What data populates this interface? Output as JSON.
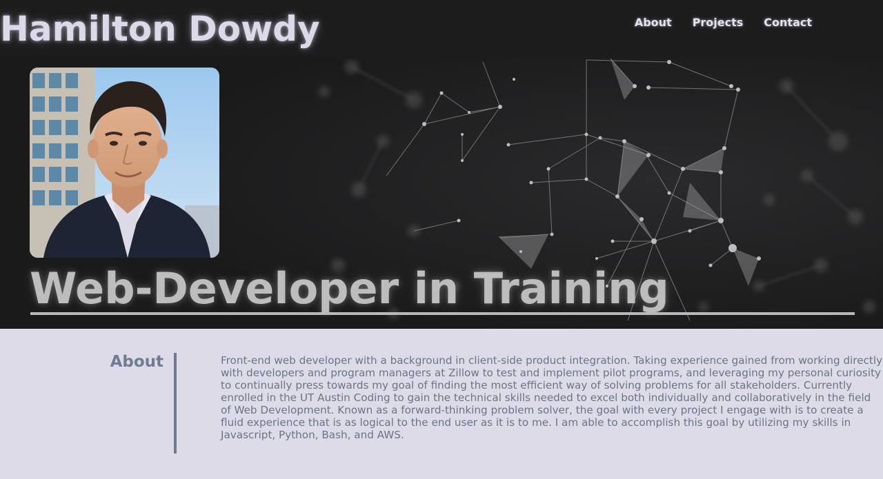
{
  "header": {
    "site_title": "Hamilton Dowdy",
    "nav": [
      {
        "label": "About"
      },
      {
        "label": "Projects"
      },
      {
        "label": "Contact"
      }
    ]
  },
  "hero": {
    "title": "Web-Developer in Training"
  },
  "about": {
    "heading": "About",
    "body": "Front-end web developer with a background in client-side product integration. Taking experience gained from working directly with developers and program managers at Zillow to test and implement pilot programs, and leveraging my personal curiosity to continually press towards my goal of finding the most efficient way of solving problems for all stakeholders. Currently enrolled in the UT Austin Coding to gain the technical skills needed to excel both individually and collaboratively in the field of Web Development. Known as a forward-thinking problem solver, the goal with every project I engage with is to create a fluid experience that is as logical to the end user as it is to me. I am able to accomplish this goal by utilizing my skills in Javascript, Python, Bash, and AWS."
  },
  "colors": {
    "header_bg": "#1c1c1d",
    "title_text": "#dcd9e9",
    "about_bg": "#dedbe8",
    "about_text": "#6a7487",
    "accent_divider": "#6e7a8e"
  }
}
